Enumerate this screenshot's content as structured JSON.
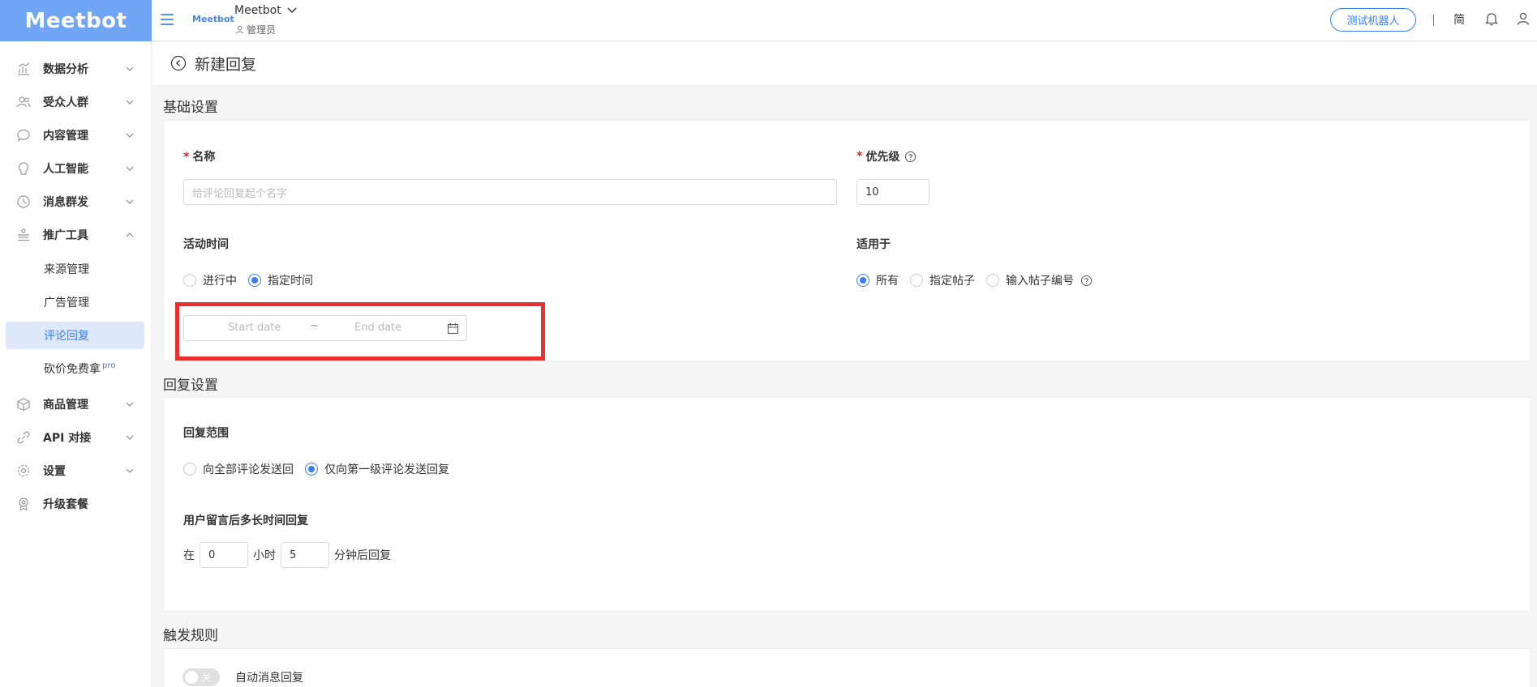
{
  "header": {
    "logo": "Meetbot",
    "mini_logo": "Meetbot",
    "account_name": "Meetbot",
    "account_role": "管理员",
    "test_bot_label": "测试机器人",
    "lang_label": "简"
  },
  "sidebar": {
    "items": [
      {
        "label": "数据分析",
        "icon": "chart-icon"
      },
      {
        "label": "受众人群",
        "icon": "users-icon"
      },
      {
        "label": "内容管理",
        "icon": "chat-icon"
      },
      {
        "label": "人工智能",
        "icon": "ai-icon"
      },
      {
        "label": "消息群发",
        "icon": "clock-icon"
      },
      {
        "label": "推广工具",
        "icon": "promote-icon"
      },
      {
        "label": "商品管理",
        "icon": "box-icon"
      },
      {
        "label": "API 对接",
        "icon": "api-icon"
      },
      {
        "label": "设置",
        "icon": "gear-icon"
      },
      {
        "label": "升级套餐",
        "icon": "badge-icon"
      }
    ],
    "sub_items": [
      {
        "label": "来源管理"
      },
      {
        "label": "广告管理"
      },
      {
        "label": "评论回复",
        "active": true
      },
      {
        "label": "砍价免费拿",
        "tag": "pro"
      }
    ]
  },
  "page": {
    "title": "新建回复"
  },
  "basic": {
    "section_title": "基础设置",
    "name_label": "名称",
    "name_placeholder": "给评论回复起个名字",
    "priority_label": "优先级",
    "priority_value": "10",
    "time_label": "活动时间",
    "time_options": [
      "进行中",
      "指定时间"
    ],
    "time_selected": "指定时间",
    "start_placeholder": "Start date",
    "date_sep": "~",
    "end_placeholder": "End date",
    "apply_label": "适用于",
    "apply_options": [
      "所有",
      "指定帖子",
      "输入帖子编号"
    ],
    "apply_selected": "所有"
  },
  "reply": {
    "section_title": "回复设置",
    "scope_label": "回复范围",
    "scope_options": [
      "向全部评论发送回",
      "仅向第一级评论发送回复"
    ],
    "scope_selected": "仅向第一级评论发送回复",
    "delay_label": "用户留言后多长时间回复",
    "delay_prefix": "在",
    "hours_value": "0",
    "hours_unit": "小时",
    "minutes_value": "5",
    "minutes_suffix": "分钟后回复"
  },
  "trigger": {
    "section_title": "触发规则",
    "toggle_text": "关",
    "toggle_label": "自动消息回复"
  },
  "colors": {
    "brand": "#70a5f5",
    "accent": "#3a7cf1",
    "highlight": "#e8302f"
  }
}
